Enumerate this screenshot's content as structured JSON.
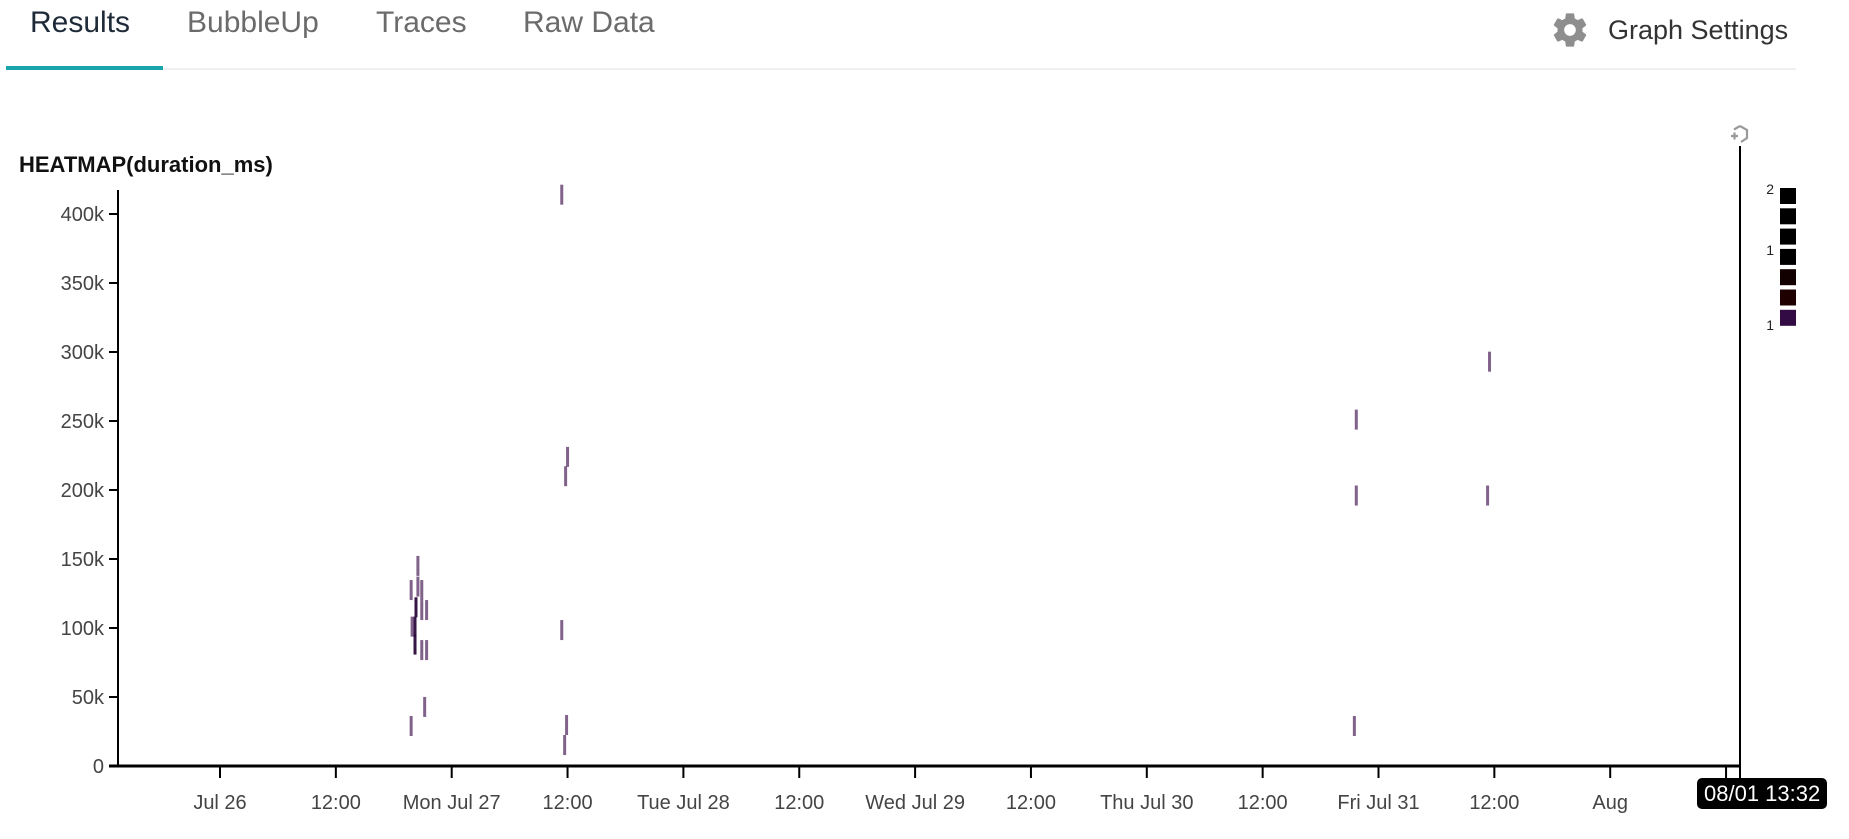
{
  "tabs": [
    {
      "label": "Results",
      "active": true
    },
    {
      "label": "BubbleUp",
      "active": false
    },
    {
      "label": "Traces",
      "active": false
    },
    {
      "label": "Raw Data",
      "active": false
    }
  ],
  "toolbar": {
    "graph_settings_label": "Graph Settings",
    "graph_settings_icon": "gear-icon"
  },
  "colors": {
    "accent": "#18a4a9",
    "cell_low": "#7a5a85",
    "cell_mid": "#2a0a3a",
    "cell_high": "#000000"
  },
  "chart_data": {
    "type": "heatmap",
    "title": "HEATMAP(duration_ms)",
    "xlabel": "",
    "ylabel": "duration_ms",
    "x_unit": "hours since Jul 26 00:00",
    "xlim": [
      -9.4,
      157.5
    ],
    "ylim": [
      0,
      420000
    ],
    "y_ticks": [
      {
        "value": 0,
        "label": "0"
      },
      {
        "value": 50000,
        "label": "50k"
      },
      {
        "value": 100000,
        "label": "100k"
      },
      {
        "value": 150000,
        "label": "150k"
      },
      {
        "value": 200000,
        "label": "200k"
      },
      {
        "value": 250000,
        "label": "250k"
      },
      {
        "value": 300000,
        "label": "300k"
      },
      {
        "value": 350000,
        "label": "350k"
      },
      {
        "value": 400000,
        "label": "400k"
      }
    ],
    "x_ticks": [
      {
        "value": 0,
        "label": "Jul 26"
      },
      {
        "value": 12,
        "label": "12:00"
      },
      {
        "value": 24,
        "label": "Mon Jul 27"
      },
      {
        "value": 36,
        "label": "12:00"
      },
      {
        "value": 48,
        "label": "Tue Jul 28"
      },
      {
        "value": 60,
        "label": "12:00"
      },
      {
        "value": 72,
        "label": "Wed Jul 29"
      },
      {
        "value": 84,
        "label": "12:00"
      },
      {
        "value": 96,
        "label": "Thu Jul 30"
      },
      {
        "value": 108,
        "label": "12:00"
      },
      {
        "value": 120,
        "label": "Fri Jul 31"
      },
      {
        "value": 132,
        "label": "12:00"
      },
      {
        "value": 144,
        "label": "Aug"
      },
      {
        "value": 156,
        "label": ""
      }
    ],
    "end_label": "08/01 13:32",
    "bucket_height_ms": 14500,
    "cells": [
      {
        "x": 35.4,
        "y": 414000,
        "count": 1
      },
      {
        "x": 36.0,
        "y": 224000,
        "count": 1
      },
      {
        "x": 35.8,
        "y": 210000,
        "count": 1
      },
      {
        "x": 35.4,
        "y": 98500,
        "count": 1
      },
      {
        "x": 35.9,
        "y": 29700,
        "count": 1
      },
      {
        "x": 35.7,
        "y": 15200,
        "count": 1
      },
      {
        "x": 19.8,
        "y": 127500,
        "count": 1
      },
      {
        "x": 20.5,
        "y": 145000,
        "count": 1
      },
      {
        "x": 20.5,
        "y": 130000,
        "count": 1
      },
      {
        "x": 20.3,
        "y": 115000,
        "count": 2
      },
      {
        "x": 20.9,
        "y": 127500,
        "count": 1
      },
      {
        "x": 20.9,
        "y": 113000,
        "count": 1
      },
      {
        "x": 20.2,
        "y": 101000,
        "count": 2
      },
      {
        "x": 19.9,
        "y": 101000,
        "count": 1
      },
      {
        "x": 20.2,
        "y": 88000,
        "count": 2
      },
      {
        "x": 20.9,
        "y": 84000,
        "count": 1
      },
      {
        "x": 21.4,
        "y": 84000,
        "count": 1
      },
      {
        "x": 21.4,
        "y": 113000,
        "count": 1
      },
      {
        "x": 19.8,
        "y": 29000,
        "count": 1
      },
      {
        "x": 21.2,
        "y": 42800,
        "count": 1
      },
      {
        "x": 117.7,
        "y": 251000,
        "count": 1
      },
      {
        "x": 117.7,
        "y": 196000,
        "count": 1
      },
      {
        "x": 117.5,
        "y": 29000,
        "count": 1
      },
      {
        "x": 131.5,
        "y": 293000,
        "count": 1
      },
      {
        "x": 131.3,
        "y": 196000,
        "count": 1
      }
    ],
    "legend": {
      "placement": "top-right",
      "labels": [
        {
          "index": 0,
          "text": "2"
        },
        {
          "index": 3,
          "text": "1"
        },
        {
          "index": 6,
          "text": "1"
        }
      ],
      "swatches": [
        "#000000",
        "#000000",
        "#000000",
        "#000000",
        "#120000",
        "#1e0000",
        "#320a44"
      ]
    }
  }
}
